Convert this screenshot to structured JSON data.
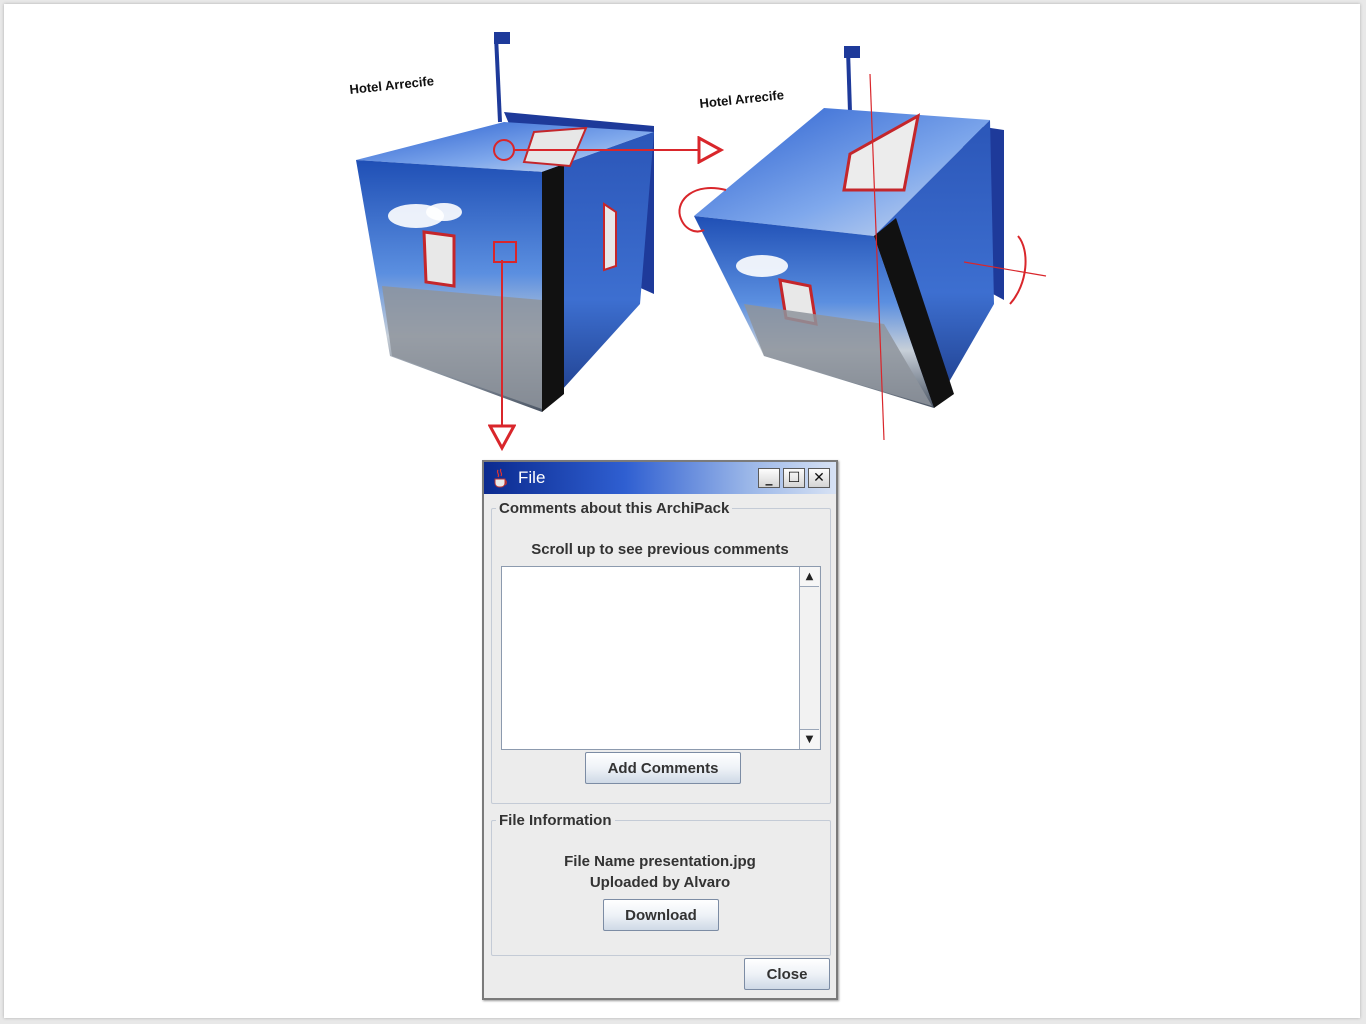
{
  "scene": {
    "cube_left_label": "Hotel Arrecife",
    "cube_right_label": "Hotel Arrecife"
  },
  "dialog": {
    "title": "File",
    "controls": {
      "minimize": "_",
      "maximize": "☐",
      "close": "✕"
    },
    "comments_group": {
      "legend": "Comments about this ArchiPack",
      "hint": "Scroll up to see previous comments",
      "textarea_value": "",
      "add_button": "Add Comments"
    },
    "file_group": {
      "legend": "File Information",
      "file_name_line": "File Name  presentation.jpg",
      "uploaded_line": "Uploaded by  Alvaro",
      "download_button": "Download"
    },
    "close_button": "Close"
  },
  "colors": {
    "title_bar": "#0b2a8f",
    "annotation_red": "#d9262b",
    "flag_blue": "#1e3a9a"
  },
  "icons": [
    "java-cup-icon",
    "minimize-icon",
    "maximize-icon",
    "close-icon",
    "scroll-up-icon",
    "scroll-down-icon",
    "rotate-arrow-icon"
  ]
}
